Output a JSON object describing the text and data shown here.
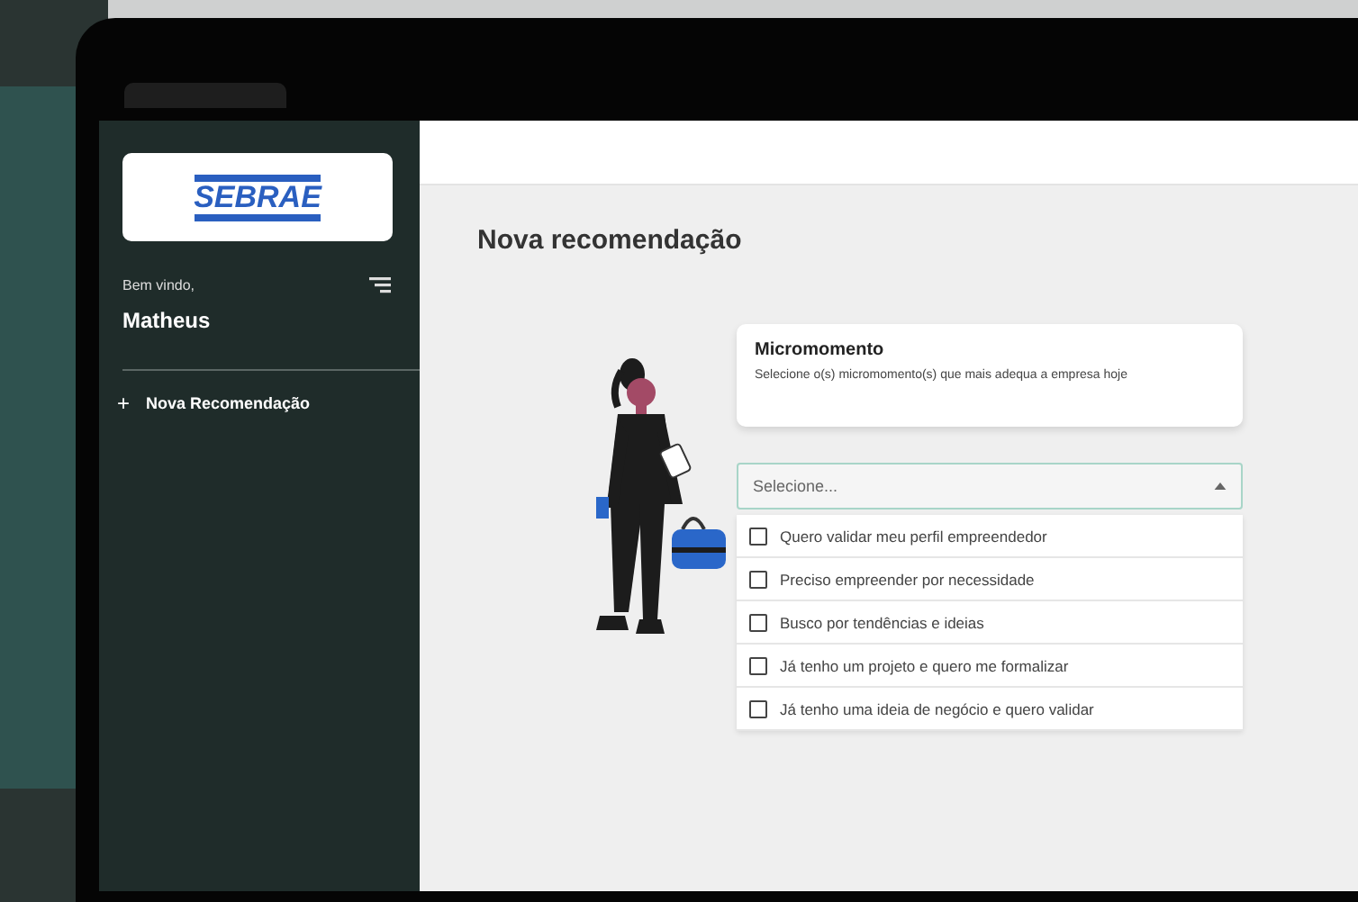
{
  "sidebar": {
    "logo": "SEBRAE",
    "greeting": "Bem vindo,",
    "user": "Matheus",
    "items": [
      {
        "icon": "+",
        "label": "Nova Recomendação"
      }
    ]
  },
  "main": {
    "title": "Nova recomendação",
    "card": {
      "title": "Micromomento",
      "text": "Selecione o(s) micromomento(s) que mais adequa a empresa hoje"
    },
    "select": {
      "placeholder": "Selecione...",
      "expanded": true
    },
    "options": [
      {
        "label": "Quero validar meu perfil empreendedor",
        "checked": false
      },
      {
        "label": "Preciso empreender por necessidade",
        "checked": false
      },
      {
        "label": "Busco por tendências e ideias",
        "checked": false
      },
      {
        "label": "Já tenho um projeto e quero me formalizar",
        "checked": false
      },
      {
        "label": "Já tenho uma ideia de negócio e quero validar",
        "checked": false
      }
    ]
  }
}
